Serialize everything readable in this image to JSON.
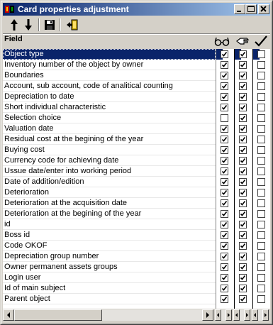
{
  "window": {
    "title": "Card properties adjustment"
  },
  "toolbar": {
    "buttons": [
      {
        "name": "move-up",
        "icon": "arrow-up-icon"
      },
      {
        "name": "move-down",
        "icon": "arrow-down-icon"
      },
      {
        "name": "save",
        "icon": "floppy-disk-icon"
      },
      {
        "name": "exit",
        "icon": "exit-door-icon"
      }
    ]
  },
  "header": {
    "field_label": "Field",
    "columns": [
      {
        "icon": "glasses-icon"
      },
      {
        "icon": "hand-pointer-icon"
      },
      {
        "icon": "checkmark-icon"
      }
    ]
  },
  "rows": [
    {
      "label": "Object type",
      "view": true,
      "edit": true,
      "required": false,
      "selected": true
    },
    {
      "label": "Inventory number of the object by owner",
      "view": true,
      "edit": true,
      "required": false
    },
    {
      "label": "Boundaries",
      "view": true,
      "edit": true,
      "required": false
    },
    {
      "label": "Account, sub account, code of analitical counting",
      "view": true,
      "edit": true,
      "required": false
    },
    {
      "label": "Depreciation to date",
      "view": true,
      "edit": true,
      "required": false
    },
    {
      "label": "Short individual characteristic",
      "view": true,
      "edit": true,
      "required": false
    },
    {
      "label": "Selection choice",
      "view": false,
      "edit": true,
      "required": false
    },
    {
      "label": "Valuation date",
      "view": true,
      "edit": true,
      "required": false
    },
    {
      "label": "Residual cost at the begining of the year",
      "view": true,
      "edit": true,
      "required": false
    },
    {
      "label": "Buying cost",
      "view": true,
      "edit": true,
      "required": false
    },
    {
      "label": "Currency code for achieving date",
      "view": true,
      "edit": true,
      "required": false
    },
    {
      "label": "Ussue date/enter into working period",
      "view": true,
      "edit": true,
      "required": false
    },
    {
      "label": "Date of addition/edition",
      "view": true,
      "edit": true,
      "required": false
    },
    {
      "label": "Deterioration",
      "view": true,
      "edit": true,
      "required": false
    },
    {
      "label": "Deterioration at the acquisition date",
      "view": true,
      "edit": true,
      "required": false
    },
    {
      "label": "Deterioration at the begining of the year",
      "view": true,
      "edit": true,
      "required": false
    },
    {
      "label": "id",
      "view": true,
      "edit": true,
      "required": false
    },
    {
      "label": "Boss id",
      "view": true,
      "edit": true,
      "required": false
    },
    {
      "label": "Code OKOF",
      "view": true,
      "edit": true,
      "required": false
    },
    {
      "label": "Depreciation group number",
      "view": true,
      "edit": true,
      "required": false
    },
    {
      "label": "Owner permanent assets groups",
      "view": true,
      "edit": true,
      "required": false
    },
    {
      "label": "Login user",
      "view": true,
      "edit": true,
      "required": false
    },
    {
      "label": "Id of main subject",
      "view": true,
      "edit": true,
      "required": false
    },
    {
      "label": "Parent object",
      "view": true,
      "edit": true,
      "required": false
    }
  ],
  "colors": {
    "titlebar_start": "#0a246a",
    "titlebar_end": "#a6caf0",
    "selection": "#0a246a",
    "face": "#d4d0c8"
  }
}
